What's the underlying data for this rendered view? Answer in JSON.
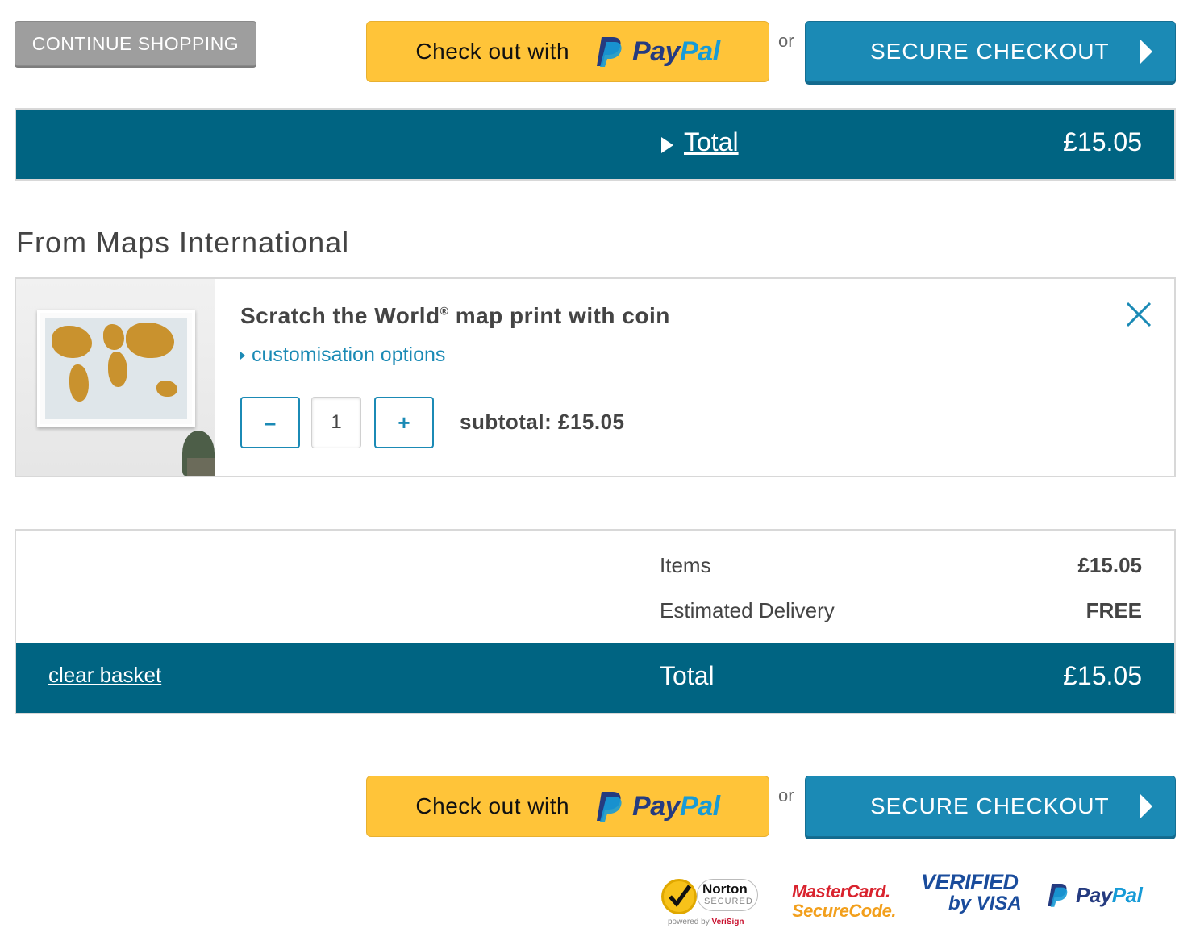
{
  "top_actions": {
    "continue_label": "CONTINUE SHOPPING",
    "paypal_label": "Check out with",
    "paypal_brand_a": "Pay",
    "paypal_brand_b": "Pal",
    "or_label": "or",
    "secure_label": "SECURE CHECKOUT"
  },
  "total_bar": {
    "label": "Total",
    "value": "£15.05"
  },
  "merchant": "From Maps International",
  "item": {
    "title": "Scratch the World",
    "title_mark": "®",
    "title_rest": " map print with coin",
    "customisation_label": "customisation options",
    "decrement_label": "–",
    "quantity": "1",
    "increment_label": "+",
    "subtotal": "subtotal: £15.05"
  },
  "summary": {
    "items_label": "Items",
    "items_value": "£15.05",
    "delivery_label": "Estimated Delivery",
    "delivery_value": "FREE",
    "clear_label": "clear basket",
    "total_label": "Total",
    "total_value": "£15.05"
  },
  "bottom_actions": {
    "paypal_label": "Check out with",
    "paypal_brand_a": "Pay",
    "paypal_brand_b": "Pal",
    "or_label": "or",
    "secure_label": "SECURE CHECKOUT"
  },
  "badges": {
    "norton_name": "Norton",
    "norton_secured": "SECURED",
    "norton_powered": "powered by",
    "norton_verisign": "VeriSign",
    "mastercard_1": "MasterCard.",
    "mastercard_2": "SecureCode.",
    "visa_1": "VERIFIED",
    "visa_2": "by VISA",
    "paypal_a": "Pay",
    "paypal_b": "Pal"
  },
  "colors": {
    "brand_teal": "#006482",
    "button_blue": "#1b8ab5",
    "paypal_yellow": "#ffc439",
    "continue_grey": "#9e9e9e"
  },
  "icons": {
    "close": "close-icon",
    "secure_arrow": "play-arrow-icon",
    "total_toggle": "play-arrow-icon",
    "paypal": "paypal-p-icon"
  }
}
